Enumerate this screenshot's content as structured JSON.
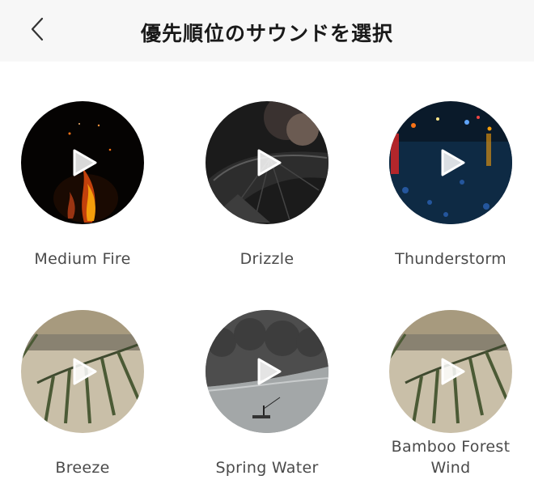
{
  "header": {
    "title": "優先順位のサウンドを選択",
    "back_icon": "chevron-left-icon"
  },
  "sounds": [
    {
      "label": "Medium Fire",
      "scene": "fire"
    },
    {
      "label": "Drizzle",
      "scene": "umbrella"
    },
    {
      "label": "Thunderstorm",
      "scene": "wet-street-night"
    },
    {
      "label": "Breeze",
      "scene": "palm-leaves"
    },
    {
      "label": "Spring Water",
      "scene": "river-boat"
    },
    {
      "label": "Bamboo Forest Wind",
      "scene": "palm-leaves"
    }
  ],
  "play_icon": "play-icon"
}
